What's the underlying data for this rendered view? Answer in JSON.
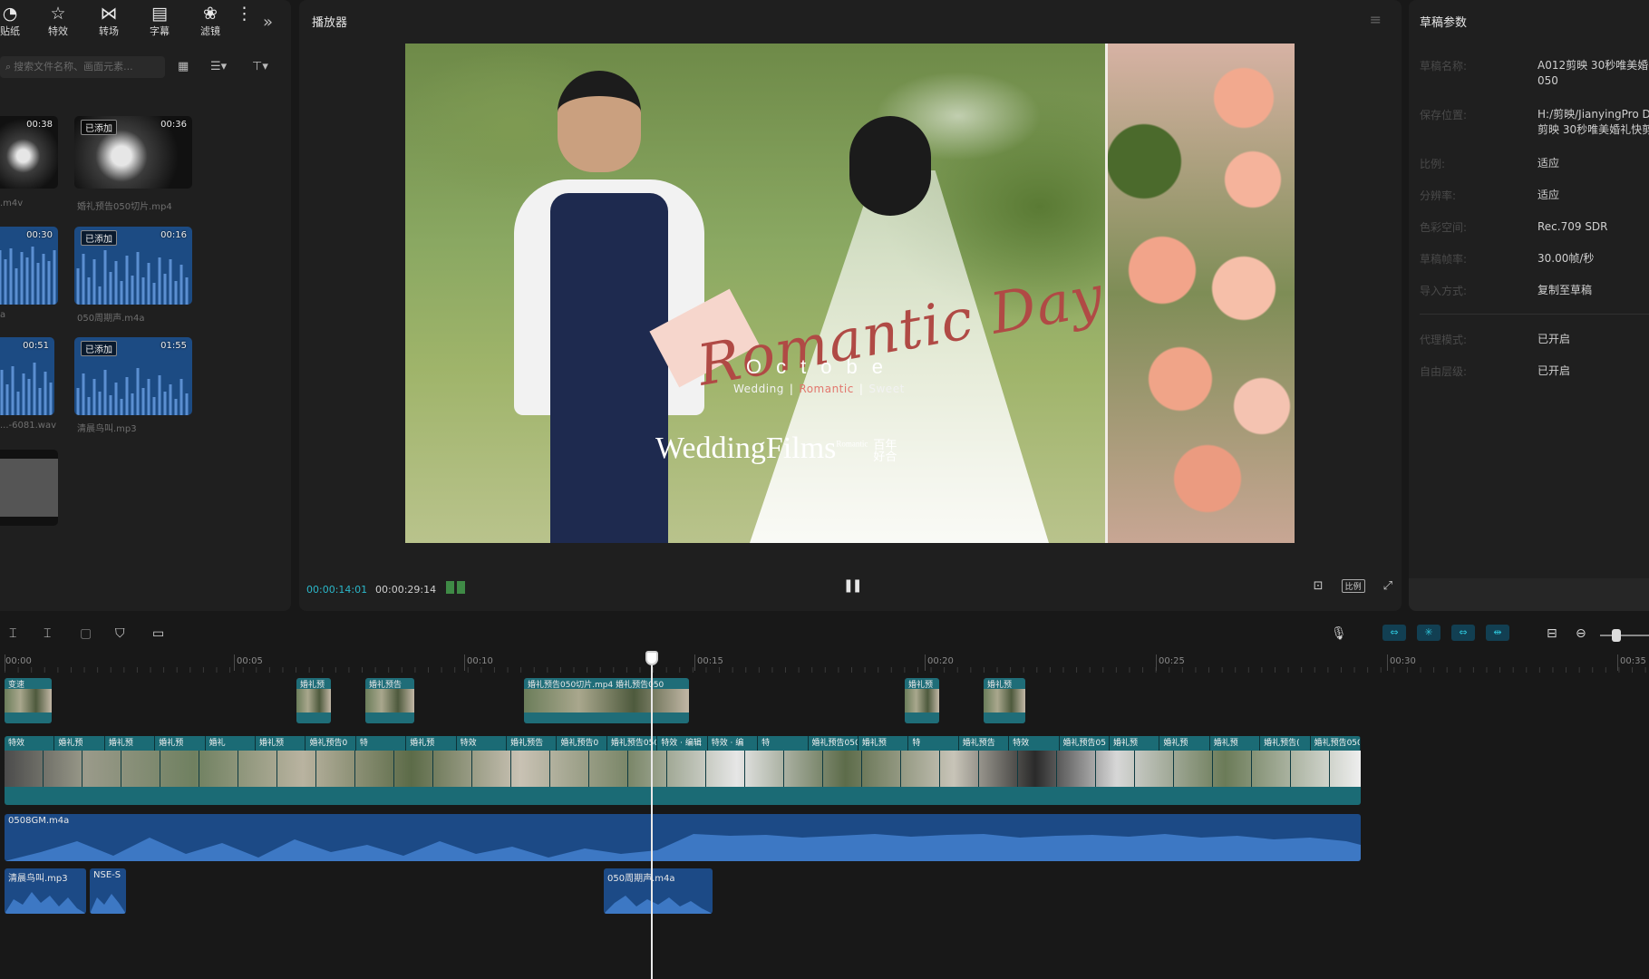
{
  "toolbar": {
    "tools": [
      {
        "label": "贴纸",
        "icon": "sticker-icon"
      },
      {
        "label": "特效",
        "icon": "effects-icon"
      },
      {
        "label": "转场",
        "icon": "transition-icon"
      },
      {
        "label": "字幕",
        "icon": "subtitle-icon"
      },
      {
        "label": "滤镜",
        "icon": "filter-icon"
      }
    ],
    "more_icon": "chevron-double-right-icon"
  },
  "media": {
    "search_placeholder": "搜索文件名称、画面元素...",
    "added_badge": "已添加",
    "items": [
      {
        "name": ".m4v",
        "duration": "00:38",
        "added": false,
        "kind": "video"
      },
      {
        "name": "婚礼预告050切片.mp4",
        "duration": "00:36",
        "added": true,
        "kind": "video"
      },
      {
        "name": "a",
        "duration": "00:30",
        "added": false,
        "kind": "audio"
      },
      {
        "name": "050周期声.m4a",
        "duration": "00:16",
        "added": true,
        "kind": "audio"
      },
      {
        "name": "...-6081.wav",
        "duration": "00:51",
        "added": false,
        "kind": "audio"
      },
      {
        "name": "清晨鸟叫.mp3",
        "duration": "01:55",
        "added": true,
        "kind": "audio"
      },
      {
        "name": "",
        "duration": "",
        "added": false,
        "kind": "image"
      }
    ]
  },
  "player": {
    "title": "播放器",
    "current_time": "00:00:14:01",
    "total_time": "00:00:29:14",
    "ratio_label": "比例",
    "overlay": {
      "script": "Romantic Day",
      "month": "Octobe",
      "tags": [
        "Wedding",
        "Romantic",
        "Sweet"
      ],
      "brand": "WeddingFilms",
      "brand_small": "Romantic",
      "brand_cn": "百年好合"
    }
  },
  "props": {
    "title": "草稿参数",
    "rows": [
      {
        "label": "草稿名称:",
        "value": "A012剪映 30秒唯美婚礼\n050"
      },
      {
        "label": "保存位置:",
        "value": "H:/剪映/JianyingPro D\n剪映 30秒唯美婚礼快剪"
      },
      {
        "label": "比例:",
        "value": "适应"
      },
      {
        "label": "分辨率:",
        "value": "适应"
      },
      {
        "label": "色彩空间:",
        "value": "Rec.709 SDR"
      },
      {
        "label": "草稿帧率:",
        "value": "30.00帧/秒"
      },
      {
        "label": "导入方式:",
        "value": "复制至草稿"
      },
      {
        "label": "代理模式:",
        "value": "已开启"
      },
      {
        "label": "自由层级:",
        "value": "已开启"
      }
    ]
  },
  "timeline": {
    "ruler": [
      "00:00",
      "00:05",
      "00:10",
      "00:15",
      "00:20",
      "00:25",
      "00:30",
      "00:35"
    ],
    "overlay_clips": [
      {
        "label": "变速"
      },
      {
        "label": "婚礼预"
      },
      {
        "label": "婚礼预告"
      },
      {
        "label": "婚礼预告050切片.mp4 婚礼预告050"
      },
      {
        "label": "婚礼预"
      },
      {
        "label": "婚礼预"
      }
    ],
    "main_segments": [
      "特效",
      "婚礼预",
      "婚礼预",
      "婚礼预",
      "婚礼",
      "婚礼预",
      "婚礼预告0",
      "特",
      "婚礼预",
      "特效",
      "婚礼预告",
      "婚礼预告0",
      "婚礼预告050切片.r",
      "特效 · 编辑",
      "特效 · 编",
      "特",
      "婚礼预告050",
      "婚礼预",
      "特",
      "婚礼预告",
      "特效",
      "婚礼预告05",
      "婚礼预",
      "婚礼预",
      "婚礼预",
      "婚礼预告(",
      "婚礼预告050切片.mp4"
    ],
    "bgm_label": "0508GM.m4a",
    "sfx": [
      {
        "label": "清晨鸟叫.mp3"
      },
      {
        "label": "NSE-S"
      },
      {
        "label": "050周期声.m4a"
      }
    ]
  },
  "colors": {
    "accent": "#2bb7c9",
    "video_track": "#1b6b75",
    "audio_track": "#1c4a86",
    "overlay_script": "#b04a45"
  }
}
